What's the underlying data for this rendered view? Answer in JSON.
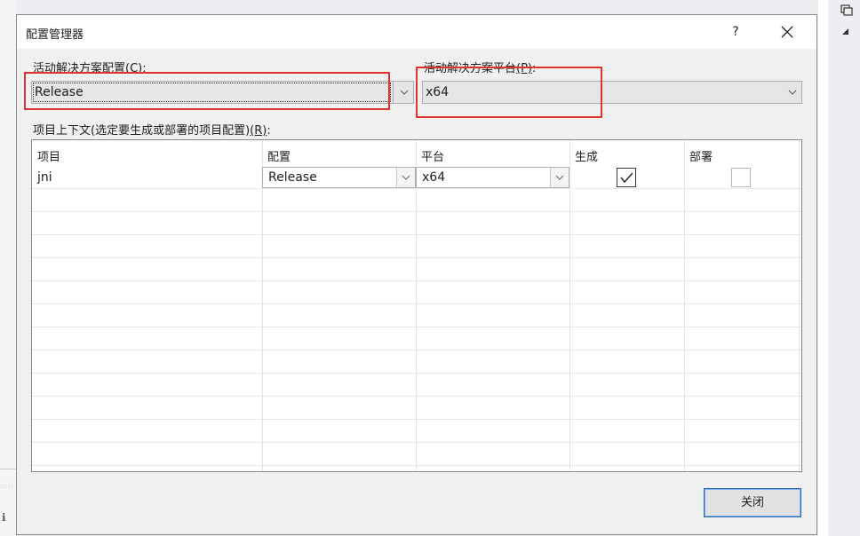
{
  "dialog": {
    "title": "配置管理器",
    "help_label": "?"
  },
  "active_config": {
    "label": "活动解决方案配置",
    "hotkey": "(C)",
    "colon": ":",
    "value": "Release"
  },
  "active_platform": {
    "label": "活动解决方案平台",
    "hotkey": "(P)",
    "colon": ":",
    "value": "x64"
  },
  "project_contexts": {
    "label": "项目上下文(选定要生成或部署的项目配置)",
    "hotkey": "(R)",
    "colon": ":",
    "columns": [
      "项目",
      "配置",
      "平台",
      "生成",
      "部署"
    ],
    "rows": [
      {
        "project": "jni",
        "configuration": "Release",
        "platform": "x64",
        "build": true,
        "deploy": false
      }
    ]
  },
  "buttons": {
    "close_label": "关闭"
  },
  "background": {
    "left_char": "ℹ"
  },
  "colors": {
    "highlight_red": "#e03030",
    "button_border": "#2b67b6"
  }
}
